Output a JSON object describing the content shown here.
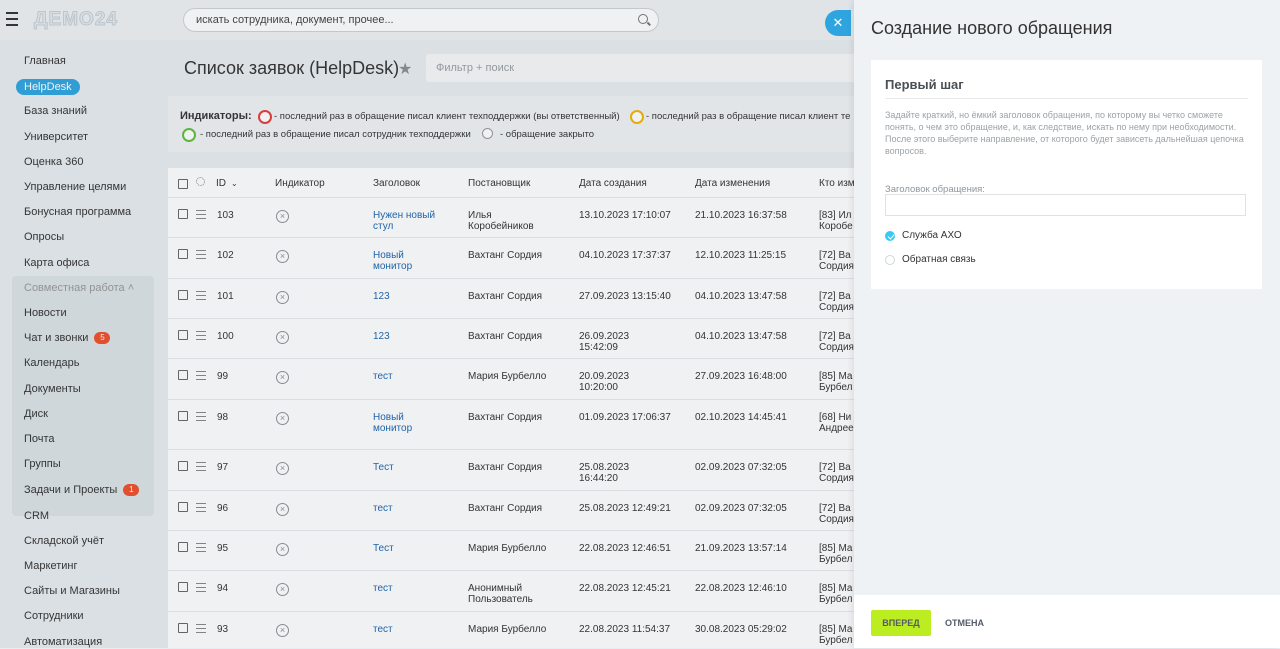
{
  "header": {
    "logo": "ДЕМО24",
    "search_placeholder": "искать сотрудника, документ, прочее..."
  },
  "sidebar": {
    "items": [
      "Главная",
      "HelpDesk",
      "База знаний",
      "Университет",
      "Оценка 360",
      "Управление целями",
      "Бонусная программа",
      "Опросы",
      "Карта офиса"
    ],
    "group_title": "Совместная работа",
    "group_items": [
      "Новости",
      "Чат и звонки",
      "Календарь",
      "Документы",
      "Диск",
      "Почта",
      "Группы"
    ],
    "chat_badge": "5",
    "after_items": [
      "Задачи и Проекты",
      "CRM",
      "Складской учёт",
      "Маркетинг",
      "Сайты и Магазины",
      "Сотрудники",
      "Автоматизация"
    ],
    "tasks_badge": "1"
  },
  "main": {
    "title": "Список заявок (HelpDesk)",
    "filter_placeholder": "Фильтр + поиск",
    "indicators": {
      "label": "Индикаторы:",
      "client_wrote": "- последний раз в обращение писал клиент техподдержки (вы ответственный)",
      "client_wrote2": "- последний раз в обращение писал клиент те",
      "staff_wrote": "- последний раз в обращение писал сотрудник техподдержки",
      "closed": "- обращение закрыто"
    },
    "columns": [
      "ID",
      "Индикатор",
      "Заголовок",
      "Постановщик",
      "Дата создания",
      "Дата изменения",
      "Кто изм"
    ],
    "rows": [
      {
        "id": "103",
        "title": "Нужен новый стул",
        "author": "Илья Коробейников",
        "created": "13.10.2023 17:10:07",
        "modified": "21.10.2023 16:37:58",
        "changer": "[83] Ил Коробе"
      },
      {
        "id": "102",
        "title": "Новый монитор",
        "author": "Вахтанг Сордия",
        "created": "04.10.2023 17:37:37",
        "modified": "12.10.2023 11:25:15",
        "changer": "[72] Ва Сордия"
      },
      {
        "id": "101",
        "title": "123",
        "author": "Вахтанг Сордия",
        "created": "27.09.2023 13:15:40",
        "modified": "04.10.2023 13:47:58",
        "changer": "[72] Ва Сордия"
      },
      {
        "id": "100",
        "title": "123",
        "author": "Вахтанг Сордия",
        "created": "26.09.2023 15:42:09",
        "modified": "04.10.2023 13:47:58",
        "changer": "[72] Ва Сордия"
      },
      {
        "id": "99",
        "title": "тест",
        "author": "Мария Бурбелло",
        "created": "20.09.2023 10:20:00",
        "modified": "27.09.2023 16:48:00",
        "changer": "[85] Ма Бурбел"
      },
      {
        "id": "98",
        "title": "Новый монитор",
        "author": "Вахтанг Сордия",
        "created": "01.09.2023 17:06:37",
        "modified": "02.10.2023 14:45:41",
        "changer": "[68] Ни Андрее"
      },
      {
        "id": "97",
        "title": "Тест",
        "author": "Вахтанг Сордия",
        "created": "25.08.2023 16:44:20",
        "modified": "02.09.2023 07:32:05",
        "changer": "[72] Ва Сордия"
      },
      {
        "id": "96",
        "title": "тест",
        "author": "Вахтанг Сордия",
        "created": "25.08.2023 12:49:21",
        "modified": "02.09.2023 07:32:05",
        "changer": "[72] Ва Сордия"
      },
      {
        "id": "95",
        "title": "Тест",
        "author": "Мария Бурбелло",
        "created": "22.08.2023 12:46:51",
        "modified": "21.09.2023 13:57:14",
        "changer": "[85] Ма Бурбел"
      },
      {
        "id": "94",
        "title": "тест",
        "author": "Анонимный Пользователь",
        "created": "22.08.2023 12:45:21",
        "modified": "22.08.2023 12:46:10",
        "changer": "[85] Ма Бурбел"
      },
      {
        "id": "93",
        "title": "тест",
        "author": "Мария Бурбелло",
        "created": "22.08.2023 11:54:37",
        "modified": "30.08.2023 05:29:02",
        "changer": "[85] Ма Бурбел"
      }
    ]
  },
  "panel": {
    "title": "Создание нового обращения",
    "step_title": "Первый шаг",
    "description": "Задайте краткий, но ёмкий заголовок обращения, по которому вы четко сможете понять, о чем это обращение, и, как следствие, искать по нему при необходимости. После этого выберите направление, от которого будет зависеть дальнейшая цепочка вопросов.",
    "field_label": "Заголовок обращения:",
    "field_value": "",
    "options": [
      {
        "label": "Служба АХО",
        "checked": true
      },
      {
        "label": "Обратная связь",
        "checked": false
      }
    ],
    "next_label": "ВПЕРЕД",
    "cancel_label": "ОТМЕНА"
  }
}
